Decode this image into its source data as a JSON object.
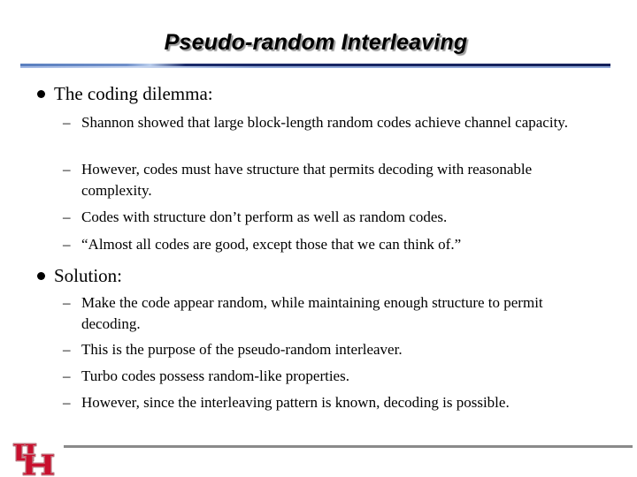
{
  "slide": {
    "title": "Pseudo-random Interleaving",
    "bullets": [
      {
        "text": "The coding dilemma:",
        "subitems": [
          {
            "dash": "–",
            "text": "Shannon showed that large block-length random codes achieve channel capacity."
          },
          {
            "dash": "–",
            "text": "However, codes must have structure that permits decoding with reasonable complexity."
          },
          {
            "dash": "–",
            "text": "Codes with structure don’t perform as well as random codes."
          },
          {
            "dash": "–",
            "text": "“Almost all codes are good, except those that we can think of.”"
          }
        ]
      },
      {
        "text": "Solution:",
        "subitems": [
          {
            "dash": "–",
            "text": "Make the code appear random, while maintaining enough structure to permit decoding."
          },
          {
            "dash": "–",
            "text": "This is the purpose of the pseudo-random interleaver."
          },
          {
            "dash": "–",
            "text": "Turbo codes possess random-like properties."
          },
          {
            "dash": "–",
            "text": "However, since the interleaving pattern is known, decoding is possible."
          }
        ]
      }
    ]
  },
  "logo": {
    "name": "UH",
    "color": "#c8102e"
  },
  "colors": {
    "title_rule_dark": "#14205a",
    "title_rule_light": "#8ea6d6",
    "footer_rule": "#8a8a8a"
  }
}
